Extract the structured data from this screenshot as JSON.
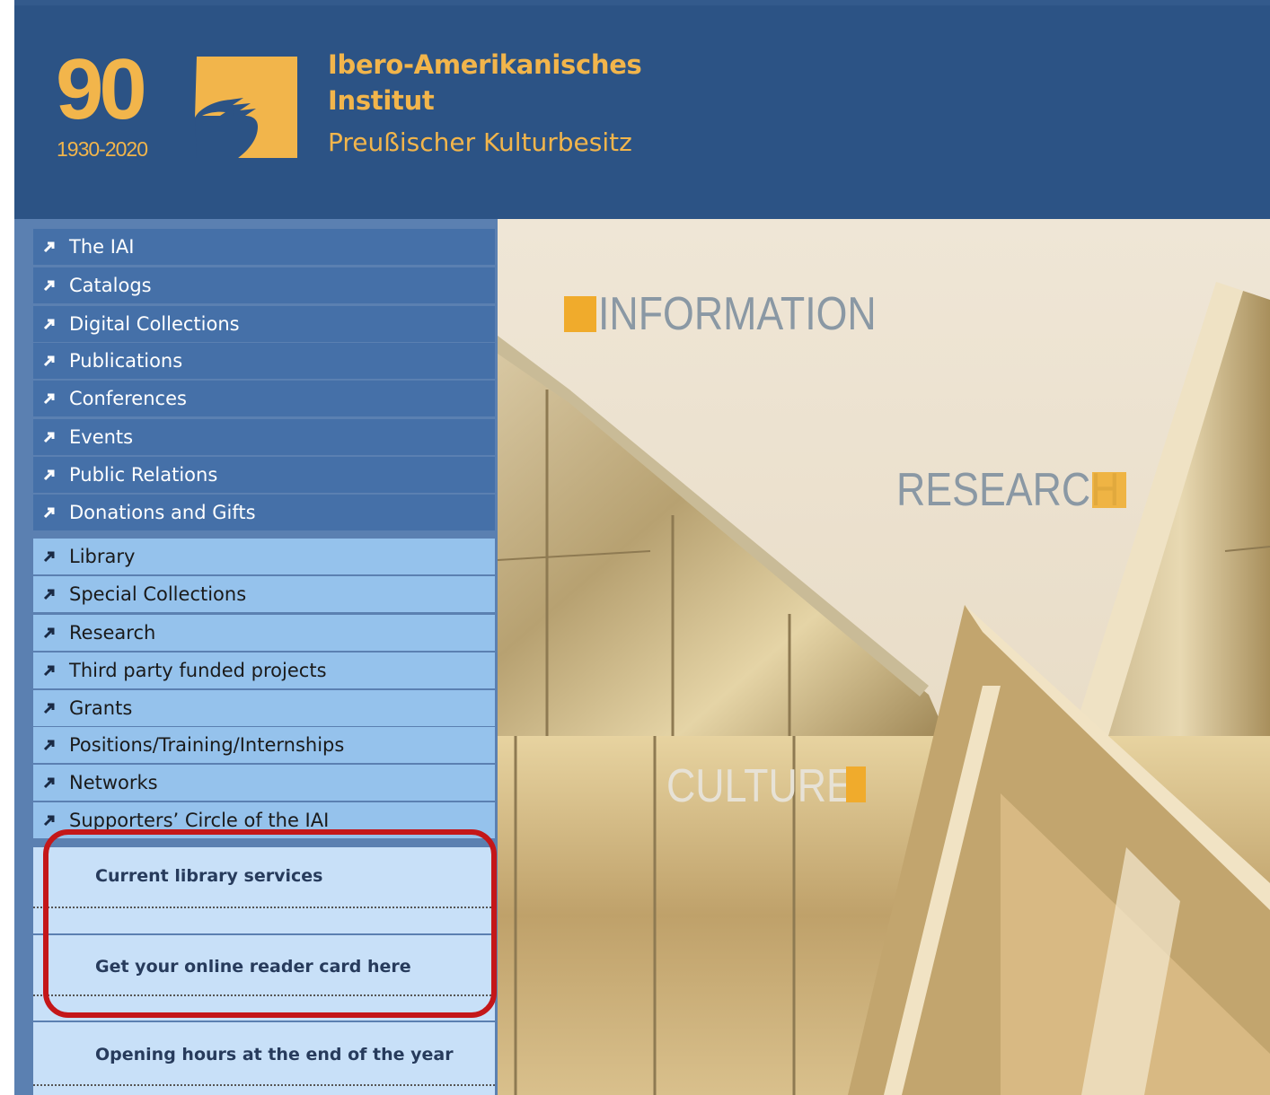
{
  "header": {
    "anniversary_number": "90",
    "anniversary_years": "1930-2020",
    "institute_line1": "Ibero-Amerikanisches",
    "institute_line2": "Institut",
    "institute_line3": "Preußischer Kulturbesitz"
  },
  "nav": {
    "primary": [
      {
        "label": "The IAI"
      },
      {
        "label": "Catalogs"
      },
      {
        "label": "Digital Collections"
      },
      {
        "label": "Publications"
      },
      {
        "label": "Conferences"
      },
      {
        "label": "Events"
      },
      {
        "label": "Public Relations"
      },
      {
        "label": "Donations and Gifts"
      }
    ],
    "secondary": [
      {
        "label": "Library"
      },
      {
        "label": "Special Collections"
      },
      {
        "label": "Research"
      },
      {
        "label": "Third party funded projects"
      },
      {
        "label": "Grants"
      },
      {
        "label": "Positions/Training/Internships"
      },
      {
        "label": "Networks"
      },
      {
        "label": "Supporters’ Circle of the IAI"
      }
    ]
  },
  "services": [
    {
      "label": "Current library services"
    },
    {
      "label": "Get your online reader card here"
    },
    {
      "label": "Opening hours at the end of the year"
    }
  ],
  "hero": {
    "word1": "INFORMATION",
    "word2": "RESEARCH",
    "word3": "CULTURE",
    "accent_color": "#f0ab2c"
  },
  "colors": {
    "header_bg": "#2c5385",
    "brand_gold": "#f2b54b",
    "nav_dark": "#4570a8",
    "nav_light": "#95c2ec",
    "highlight_annotation": "#c41719"
  },
  "icons": {
    "nav_arrow": "arrow-up-right-icon",
    "logo": "eagle-logo-icon"
  }
}
